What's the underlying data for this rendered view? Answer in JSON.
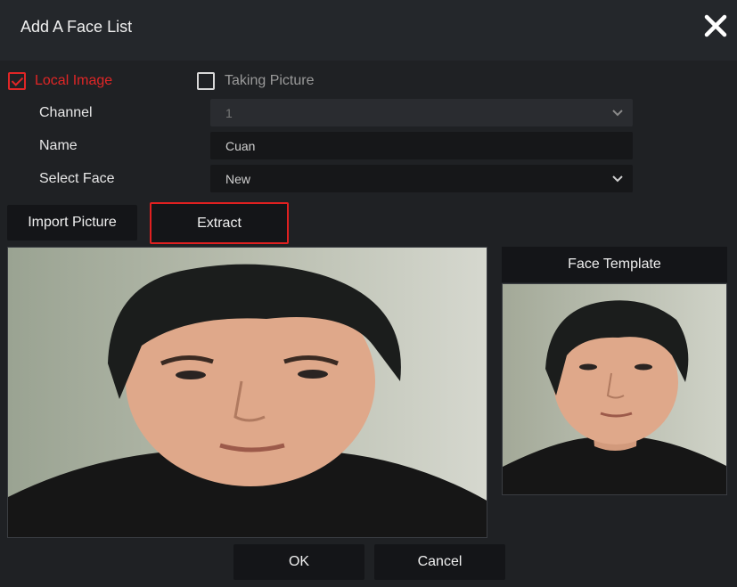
{
  "dialog": {
    "title": "Add A Face List"
  },
  "source": {
    "local_image_label": "Local Image",
    "local_image_checked": true,
    "taking_picture_label": "Taking Picture",
    "taking_picture_checked": false
  },
  "form": {
    "channel_label": "Channel",
    "channel_value": "1",
    "name_label": "Name",
    "name_value": "Cuan",
    "select_face_label": "Select Face",
    "select_face_value": "New"
  },
  "actions": {
    "import_label": "Import Picture",
    "extract_label": "Extract",
    "ok_label": "OK",
    "cancel_label": "Cancel"
  },
  "template": {
    "header": "Face Template"
  },
  "colors": {
    "accent": "#e02626",
    "background": "#1f2124",
    "panel": "#141518"
  },
  "icons": {
    "close": "close-icon",
    "dropdown": "chevron-down-icon",
    "check": "checkbox-icon"
  }
}
